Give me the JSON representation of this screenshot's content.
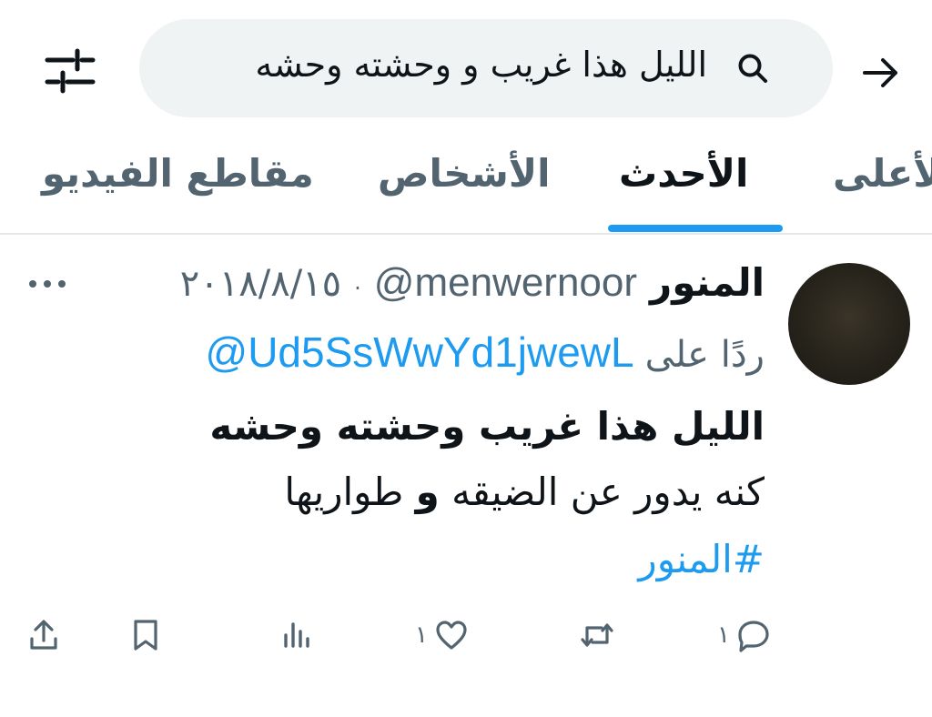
{
  "header": {
    "search_value": "الليل هذا غريب و وحشته وحشه"
  },
  "tabs": [
    {
      "label": "الأعلى",
      "active": false
    },
    {
      "label": "الأحدث",
      "active": true
    },
    {
      "label": "الأشخاص",
      "active": false
    },
    {
      "label": "مقاطع الفيديو",
      "active": false
    }
  ],
  "tweet": {
    "display_name": "المنور",
    "handle": "@menwernoor",
    "separator": "·",
    "date": "٢٠١٨/٨/١٥",
    "reply_prefix": "ردًا على",
    "reply_to": "@Ud5SsWwYd1jwewL",
    "text_line1": "الليل هذا غريب وحشته وحشه",
    "text_line2_part1": "كنه يدور عن الضيقه",
    "text_line2_bold": "و",
    "text_line2_part2": "طواريها",
    "hashtag": "#المنور",
    "actions": {
      "replies": "١",
      "likes": "١"
    }
  },
  "icons": {
    "back": "arrow-right-icon",
    "search": "search-icon",
    "filter": "sliders-icon",
    "more": "more-dots-icon",
    "reply": "comment-icon",
    "retweet": "retweet-icon",
    "like": "heart-icon",
    "views": "analytics-icon",
    "bookmark": "bookmark-icon",
    "share": "share-icon"
  },
  "colors": {
    "accent": "#1d9bf0",
    "text": "#0f1419",
    "muted": "#536471",
    "search_bg": "#eff3f4"
  }
}
